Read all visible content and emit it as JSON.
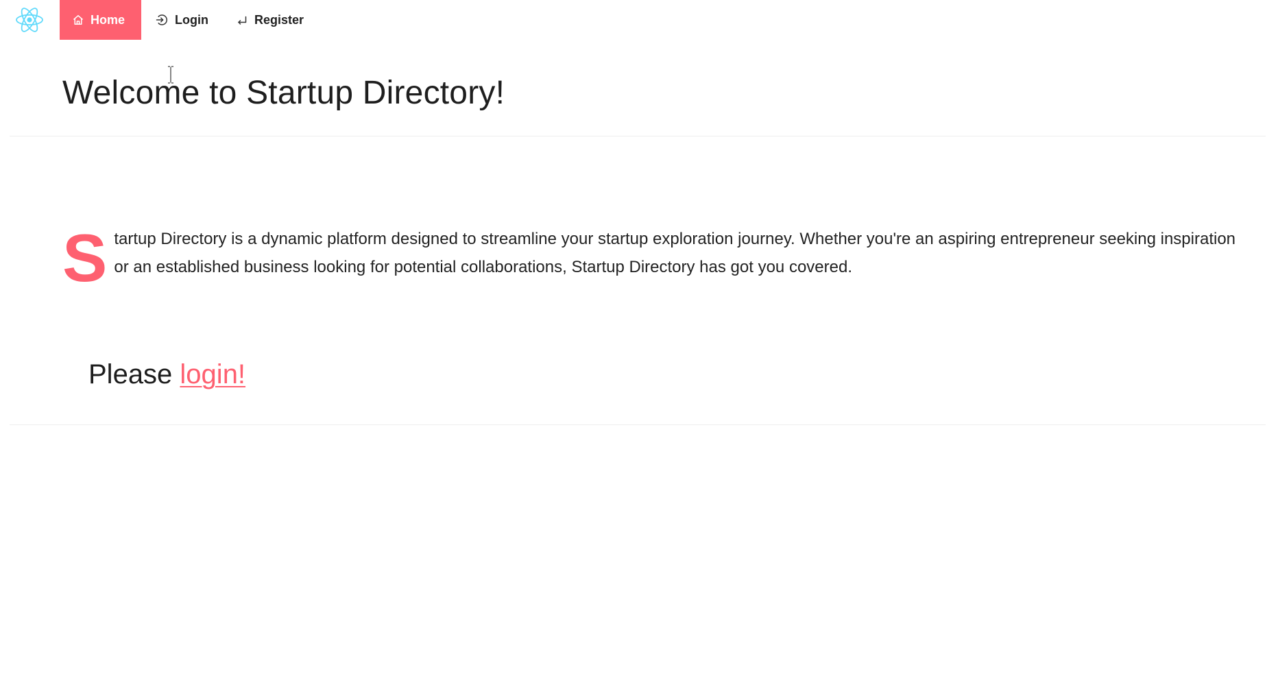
{
  "theme": {
    "accent": "#fe6070",
    "logo_color": "#61dafb"
  },
  "nav": {
    "logo_icon": "react-atom-icon",
    "items": [
      {
        "label": "Home",
        "icon": "home-icon",
        "active": true
      },
      {
        "label": "Login",
        "icon": "login-icon",
        "active": false
      },
      {
        "label": "Register",
        "icon": "register-icon",
        "active": false
      }
    ]
  },
  "header": {
    "title": "Welcome to Startup Directory!"
  },
  "intro": {
    "drop_cap": "S",
    "text": "tartup Directory is a dynamic platform designed to streamline your startup exploration journey. Whether you're an aspiring entrepreneur seeking inspiration or an established business looking for potential collaborations, Startup Directory has got you covered."
  },
  "login_prompt": {
    "prefix": "Please ",
    "link_label": "login!"
  }
}
